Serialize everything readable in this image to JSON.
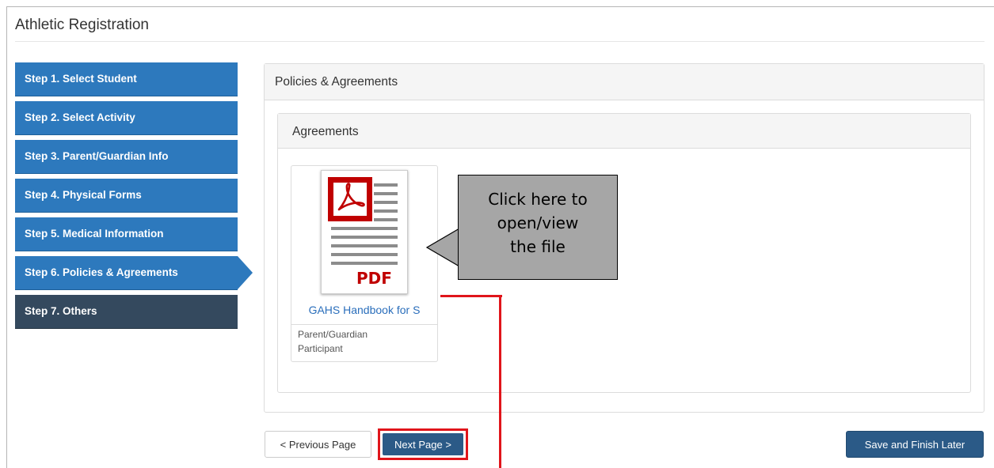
{
  "app": {
    "title": "Athletic Registration"
  },
  "steps": [
    {
      "label": "Step 1. Select Student",
      "state": "done"
    },
    {
      "label": "Step 2. Select Activity",
      "state": "done"
    },
    {
      "label": "Step 3. Parent/Guardian Info",
      "state": "done"
    },
    {
      "label": "Step 4. Physical Forms",
      "state": "done"
    },
    {
      "label": "Step 5. Medical Information",
      "state": "done"
    },
    {
      "label": "Step 6. Policies & Agreements",
      "state": "current"
    },
    {
      "label": "Step 7. Others",
      "state": "pending"
    }
  ],
  "main": {
    "panel_title": "Policies & Agreements",
    "agreements_title": "Agreements",
    "file": {
      "icon": "pdf-file-icon",
      "badge_text": "PDF",
      "link_text": "GAHS Handbook for S",
      "signers": [
        "Parent/Guardian",
        "Participant"
      ]
    }
  },
  "callout": {
    "lines": [
      "Click here to",
      "open/view",
      "the file"
    ]
  },
  "footer": {
    "prev_label": "< Previous Page",
    "next_label": "Next Page >",
    "save_label": "Save and Finish Later"
  },
  "colors": {
    "step_active": "#2d79bd",
    "step_pending": "#34495e",
    "primary_button": "#2b5a87",
    "highlight_red": "#e0151b",
    "callout_bg": "#a6a6a6",
    "link": "#2a6ebb",
    "pdf_red": "#c00000"
  }
}
